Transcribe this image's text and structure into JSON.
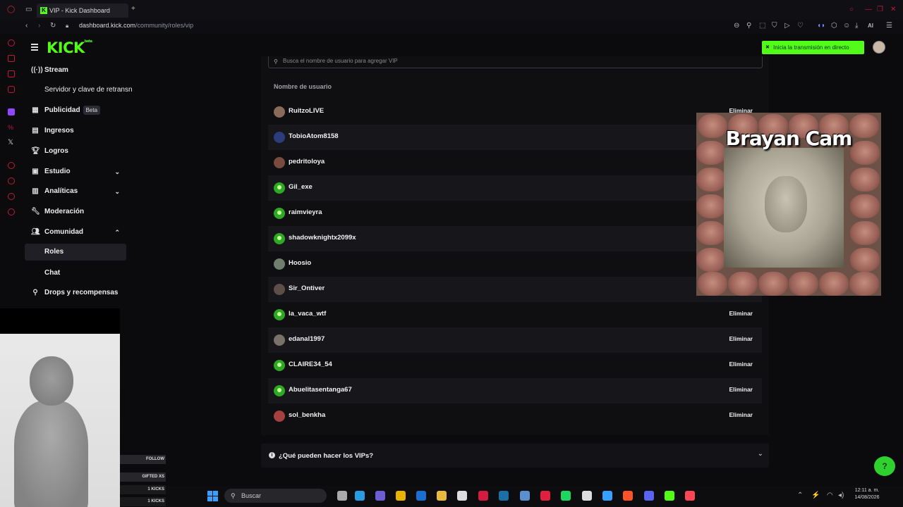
{
  "browser": {
    "tab_title": "VIP - Kick Dashboard",
    "url_domain": "dashboard.kick.com",
    "url_path": "/community/roles/vip",
    "new_tab": "+",
    "ai_label": "AI"
  },
  "logo": {
    "text": "KICK",
    "superscript": "beta"
  },
  "nav": {
    "stream": "Stream",
    "stream_key": "Servidor y clave de retransn",
    "publicidad": "Publicidad",
    "publicidad_badge": "Beta",
    "ingresos": "Ingresos",
    "logros": "Logros",
    "estudio": "Estudio",
    "analiticas": "Analíticas",
    "moderacion": "Moderación",
    "comunidad": "Comunidad",
    "roles": "Roles",
    "chat": "Chat",
    "drops": "Drops y recompensas"
  },
  "search": {
    "placeholder": "Busca el nombre de usuario para agregar VIP"
  },
  "table": {
    "header": "Nombre de usuario",
    "remove_label": "Eliminar",
    "rows": [
      {
        "name": "RuitzoLIVE",
        "avatar": "photo",
        "remove_visible": true
      },
      {
        "name": "TobioAtom8158",
        "avatar": "photo",
        "remove_visible": false
      },
      {
        "name": "pedritoloya",
        "avatar": "photo",
        "remove_visible": false
      },
      {
        "name": "Gil_exe",
        "avatar": "default-green",
        "remove_visible": false
      },
      {
        "name": "raimvieyra",
        "avatar": "default-green",
        "remove_visible": false
      },
      {
        "name": "shadowknightx2099x",
        "avatar": "default-green",
        "remove_visible": false
      },
      {
        "name": "Hoosio",
        "avatar": "photo",
        "remove_visible": false
      },
      {
        "name": "Sir_Ontiver",
        "avatar": "photo",
        "remove_visible": false
      },
      {
        "name": "la_vaca_wtf",
        "avatar": "default-green",
        "remove_visible": true
      },
      {
        "name": "edanal1997",
        "avatar": "photo",
        "remove_visible": true
      },
      {
        "name": "CLAIRE34_54",
        "avatar": "default-green",
        "remove_visible": true
      },
      {
        "name": "Abuelitasentanga67",
        "avatar": "default-green",
        "remove_visible": true
      },
      {
        "name": "sol_benkha",
        "avatar": "photo",
        "remove_visible": true
      }
    ]
  },
  "faq": {
    "label": "¿Qué pueden hacer los VIPs?"
  },
  "header_right": {
    "golive_label": "Inicia la transmisión en directo"
  },
  "cam_overlay": {
    "title": "Brayan Cam"
  },
  "stream_overlay": {
    "follow": "FOLLOW",
    "gifted": "GIFTED XS",
    "kicks1": "1 KICKS",
    "kicks2": "1 KICKS"
  },
  "taskbar": {
    "search_label": "Buscar",
    "time": "12:11 a. m.",
    "date": "14/08/2026"
  },
  "colors": {
    "accent": "#53fc18",
    "background": "#0b0b0d",
    "row_alt": "#17171b"
  }
}
